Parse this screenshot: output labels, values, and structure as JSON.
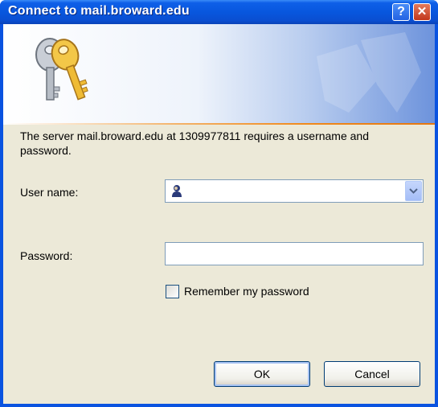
{
  "titlebar": {
    "title": "Connect to mail.broward.edu",
    "help_label": "?",
    "close_label": "✕"
  },
  "banner": {
    "icon": "keys-icon"
  },
  "message": "The server mail.broward.edu at 1309977811 requires a username and password.",
  "form": {
    "username_label": "User name:",
    "username_value": "",
    "password_label": "Password:",
    "password_value": "",
    "remember_label": "Remember my password",
    "remember_checked": false
  },
  "buttons": {
    "ok": "OK",
    "cancel": "Cancel"
  },
  "colors": {
    "titlebar": "#0857de",
    "client": "#ece9d8",
    "accent_line": "#f08a1d"
  }
}
